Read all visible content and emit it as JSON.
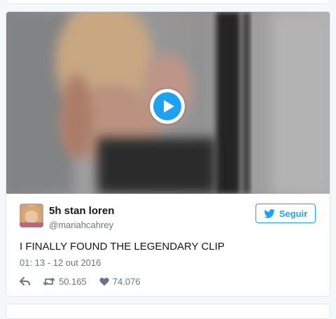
{
  "tweet": {
    "display_name": "5h stan loren",
    "handle": "@mariahcahrey",
    "follow_label": "Seguir",
    "text": "I FINALLY FOUND THE LEGENDARY CLIP",
    "timestamp": "01: 13 - 12 out 2016",
    "retweet_count": "50.165",
    "like_count": "74.076"
  },
  "icons": {
    "play": "play-icon",
    "bird": "twitter-bird-icon",
    "reply": "reply-icon",
    "retweet": "retweet-icon",
    "like": "heart-icon"
  },
  "colors": {
    "accent": "#1da1f2",
    "text": "#14171a",
    "muted": "#657786",
    "border": "#e1e8ed"
  }
}
